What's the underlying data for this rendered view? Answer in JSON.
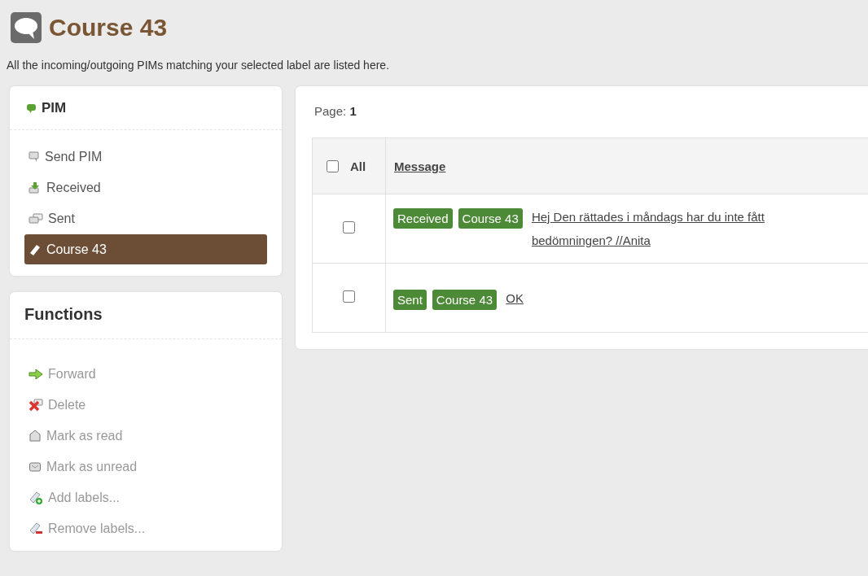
{
  "page": {
    "title": "Course 43",
    "description": "All the incoming/outgoing PIMs matching your selected label are listed here."
  },
  "pim_panel": {
    "title": "PIM",
    "items": [
      {
        "label": "Send PIM",
        "kind": "compose",
        "selected": false
      },
      {
        "label": "Received",
        "kind": "inbox",
        "selected": false
      },
      {
        "label": "Sent",
        "kind": "sent",
        "selected": false
      },
      {
        "label": "Course 43",
        "kind": "label",
        "selected": true
      }
    ]
  },
  "functions_panel": {
    "title": "Functions",
    "items": [
      {
        "label": "Forward",
        "kind": "forward",
        "disabled": true
      },
      {
        "label": "Delete",
        "kind": "delete",
        "disabled": true
      },
      {
        "label": "Mark as read",
        "kind": "read",
        "disabled": true
      },
      {
        "label": "Mark as unread",
        "kind": "unread",
        "disabled": true
      },
      {
        "label": "Add labels...",
        "kind": "add-label",
        "disabled": true
      },
      {
        "label": "Remove labels...",
        "kind": "remove-label",
        "disabled": true
      }
    ]
  },
  "messages": {
    "page_label": "Page:",
    "page_number": "1",
    "select_all": {
      "label": "All",
      "checked": false
    },
    "column": "Message",
    "rows": [
      {
        "checked": false,
        "tags": [
          "Received",
          "Course 43"
        ],
        "text": "Hej Den rättades i måndags har du inte fått bedömningen? //Anita"
      },
      {
        "checked": false,
        "tags": [
          "Sent",
          "Course 43"
        ],
        "text": "OK"
      }
    ]
  }
}
